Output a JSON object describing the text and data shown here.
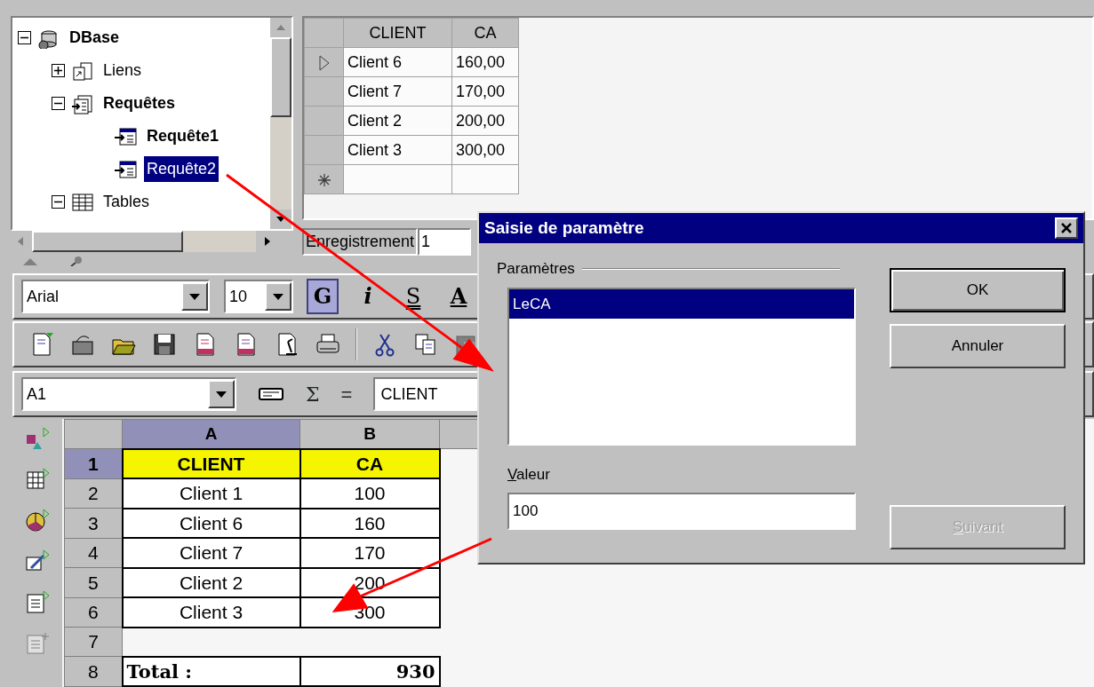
{
  "tree": {
    "items": [
      {
        "label": "DBase",
        "kind": "database",
        "bold": true,
        "selected": false,
        "expanded": true,
        "children": [
          {
            "label": "Liens",
            "kind": "links",
            "bold": false,
            "selected": false,
            "expanded": false
          },
          {
            "label": "Requêtes",
            "kind": "queries",
            "bold": true,
            "selected": false,
            "expanded": true,
            "children": [
              {
                "label": "Requête1",
                "kind": "query",
                "bold": true,
                "selected": false
              },
              {
                "label": "Requête2",
                "kind": "query",
                "bold": false,
                "selected": true
              }
            ]
          },
          {
            "label": "Tables",
            "kind": "tables",
            "bold": false,
            "selected": false,
            "expanded": true
          }
        ]
      }
    ]
  },
  "datagrid": {
    "columns": [
      "CLIENT",
      "CA"
    ],
    "rows": [
      {
        "cells": [
          "Client 6",
          "160,00"
        ],
        "current": true
      },
      {
        "cells": [
          "Client 7",
          "170,00"
        ],
        "current": false
      },
      {
        "cells": [
          "Client 2",
          "200,00"
        ],
        "current": false
      },
      {
        "cells": [
          "Client 3",
          "300,00"
        ],
        "current": false
      }
    ],
    "record_label": "Enregistrement",
    "record_value": "1"
  },
  "format_toolbar": {
    "font": "Arial",
    "size": "10",
    "buttons": [
      {
        "label": "G",
        "kind": "bold",
        "selected": true
      },
      {
        "label": "i",
        "kind": "italic",
        "selected": false
      },
      {
        "label": "S",
        "kind": "strike",
        "selected": false
      },
      {
        "label": "A",
        "kind": "color",
        "selected": false
      }
    ]
  },
  "formula_bar": {
    "cell_ref": "A1",
    "sum": "Σ",
    "equals": "=",
    "content": "CLIENT"
  },
  "sheet": {
    "columns": [
      {
        "label": "A",
        "selected": true
      },
      {
        "label": "B",
        "selected": false
      }
    ],
    "rows": [
      {
        "header": "1",
        "selected": true,
        "kind": "heading",
        "cells": [
          "CLIENT",
          "CA"
        ]
      },
      {
        "header": "2",
        "selected": false,
        "kind": "data",
        "cells": [
          "Client 1",
          "100"
        ]
      },
      {
        "header": "3",
        "selected": false,
        "kind": "data",
        "cells": [
          "Client 6",
          "160"
        ]
      },
      {
        "header": "4",
        "selected": false,
        "kind": "data",
        "cells": [
          "Client 7",
          "170"
        ]
      },
      {
        "header": "5",
        "selected": false,
        "kind": "data",
        "cells": [
          "Client 2",
          "200"
        ]
      },
      {
        "header": "6",
        "selected": false,
        "kind": "data",
        "cells": [
          "Client 3",
          "300"
        ]
      },
      {
        "header": "7",
        "selected": false,
        "kind": "empty"
      },
      {
        "header": "8",
        "selected": false,
        "kind": "total",
        "cells": [
          "Total :",
          "930"
        ]
      }
    ]
  },
  "dialog": {
    "title": "Saisie de paramètre",
    "group_label": "Paramètres",
    "params": [
      {
        "label": "LeCA",
        "selected": true
      }
    ],
    "value_label": "Valeur",
    "value": "100",
    "buttons": [
      {
        "label": "OK",
        "disabled": false,
        "default": true
      },
      {
        "label": "Annuler",
        "disabled": false,
        "default": false
      },
      {
        "label": "Suivant",
        "disabled": true,
        "default": false
      }
    ]
  }
}
